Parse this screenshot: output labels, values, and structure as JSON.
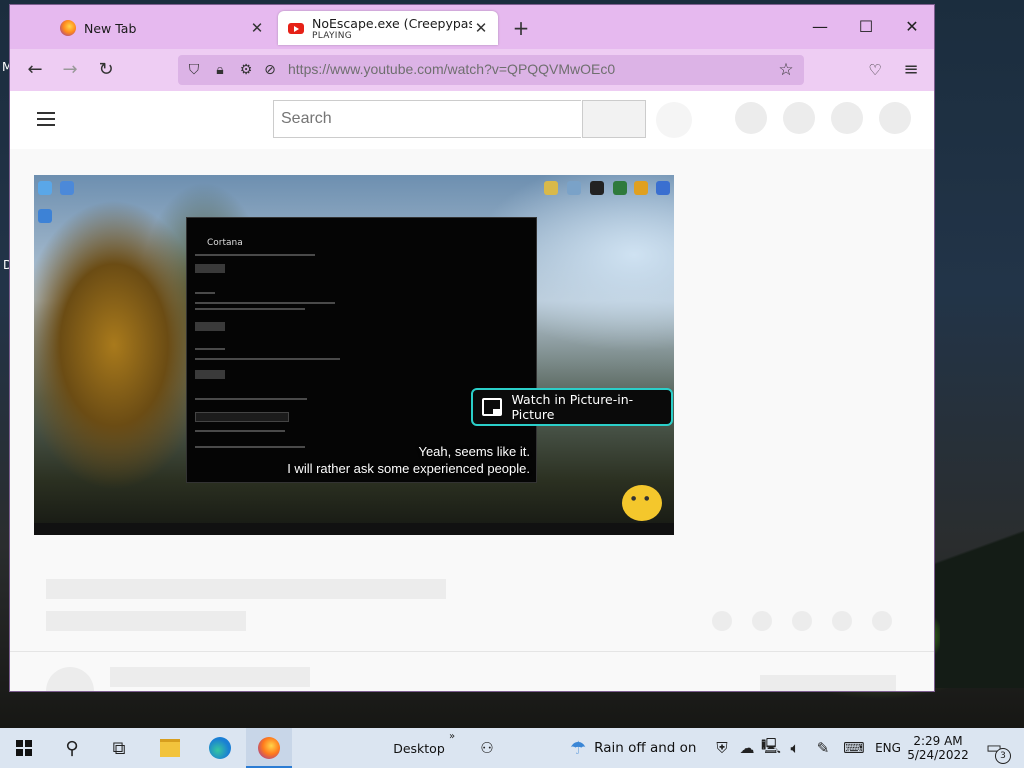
{
  "desktop": {
    "fragment_m": "M",
    "fragment_d": "D"
  },
  "browser": {
    "tabs": [
      {
        "title": "New Tab",
        "subtitle": ""
      },
      {
        "title": "NoEscape.exe (Creepypasta) - Y",
        "subtitle": "PLAYING"
      }
    ],
    "new_tab_glyph": "+",
    "close_glyph": "✕",
    "window_controls": {
      "minimize": "—",
      "maximize": "☐",
      "close": "✕"
    },
    "url": "https://www.youtube.com/watch?v=QPQQVMwOEc0",
    "icons": [
      "back-icon",
      "forward-icon",
      "reload-icon",
      "shield-icon",
      "lock-icon",
      "permissions-icon",
      "autoplay-blocked-icon",
      "bookmark-star-icon",
      "pocket-icon",
      "menu-icon"
    ]
  },
  "youtube": {
    "search_placeholder": "Search",
    "video": {
      "inner_window_title": "Cortana",
      "subtitle_line1": "Yeah, seems like it.",
      "subtitle_line2": "I will rather ask some experienced people.",
      "pip_label": "Watch in Picture-in-Picture"
    }
  },
  "taskbar": {
    "desktop_label": "Desktop",
    "toolbar_chevron": "»",
    "weather_text": "Rain off and on",
    "language": "ENG",
    "time": "2:29 AM",
    "date": "5/24/2022",
    "notification_count": "3"
  },
  "colors": {
    "titlebar": "#e6b9ef",
    "navbar": "#eecdf3",
    "urlbar": "#dcb3e6",
    "pip_border": "#2bcfc9",
    "taskbar": "#dbe5f1"
  }
}
